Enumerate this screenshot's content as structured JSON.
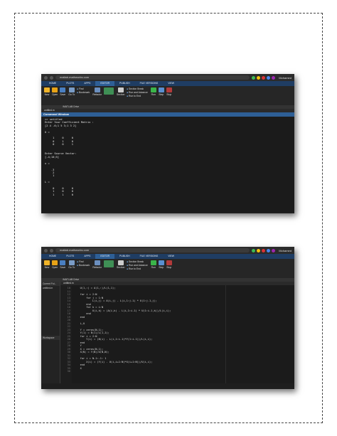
{
  "browser": {
    "url": "matlab.mathworks.com",
    "user": "Mohamed"
  },
  "tabs": [
    "HOME",
    "PLOTS",
    "APPS",
    "EDITOR",
    "PUBLISH",
    "FILE VERSIONS",
    "VIEW"
  ],
  "active_tab": "EDITOR",
  "ribbon": {
    "new": "New",
    "open": "Open",
    "save": "Save",
    "goto": "Go To",
    "find": "Find",
    "bookmark": "Bookmark",
    "refactor": "Refactor",
    "section": "Section",
    "section_break": "Section Break",
    "run_advance": "Run and Advance",
    "run_to_end": "Run to End",
    "run": "Run",
    "step": "Step",
    "stop": "Stop",
    "groups": [
      "FILE",
      "NAVIGATE",
      "CODE",
      "SECTION",
      "RUN"
    ]
  },
  "path": "/MATLAB Drive",
  "file_tab": "untitled.m",
  "console": {
    "title": "Command Window",
    "text": ">> untitled\nEnter Your Coefficient Matrix :\n[2 4 -6;1 5 3;1 3 2]\n\nU =\n\n     1     0     0\n     0     1     0\n     0     0     1\n\n\nEnter Source Vector:\n[-4;10;5]\n\nx =\n\n    -3\n     2\n     1\n\nL =\n\n     0     0     0\n     1     0     0\n     1     1     0"
  },
  "editor": {
    "current_folder": "Current Fol...",
    "files": [
      "untitled.m"
    ],
    "workspace": "Workspace",
    "line_numbers": "10\n11\n12\n13\n14\n15\n16\n17\n18\n19\n20\n21\n22\n23\n24\n25\n26\n27\n28\n29\n30\n31\n32\n33\n34\n35\n36",
    "code": "    U(1,:) = A(1,:)/L(1,1);\n\n    for i = 2:N\n        for j = 1:N\n            L(i,j) = A(i,j) - L(i,1:j-1) * U(1:j-1,j);\n        end\n        for k = i:N\n            U(i,k) = (A(i,k) - L(i,1:i-1) * U(1:i-1,k))/L(i,i);\n        end\n    end\n\n    L,U\n\n    Y = zeros(N,1);\n    Y(1) = B(1)/L(1,1);\n    for i = 2:N\n        Y(i) = (B(i) - L(i,1:i-1)*Y(1:i-1))/L(i,i);\n    end\n    Y\n    X = zeros(N,1);\n    X(N) = Y(N)/U(N,N);\n\n    for i = N-1:-1: 1\n        X(i) = (Y(i) - U(i,i+1:N)*X(i+1:N))/U(i,i);\n    end\n    X"
  }
}
